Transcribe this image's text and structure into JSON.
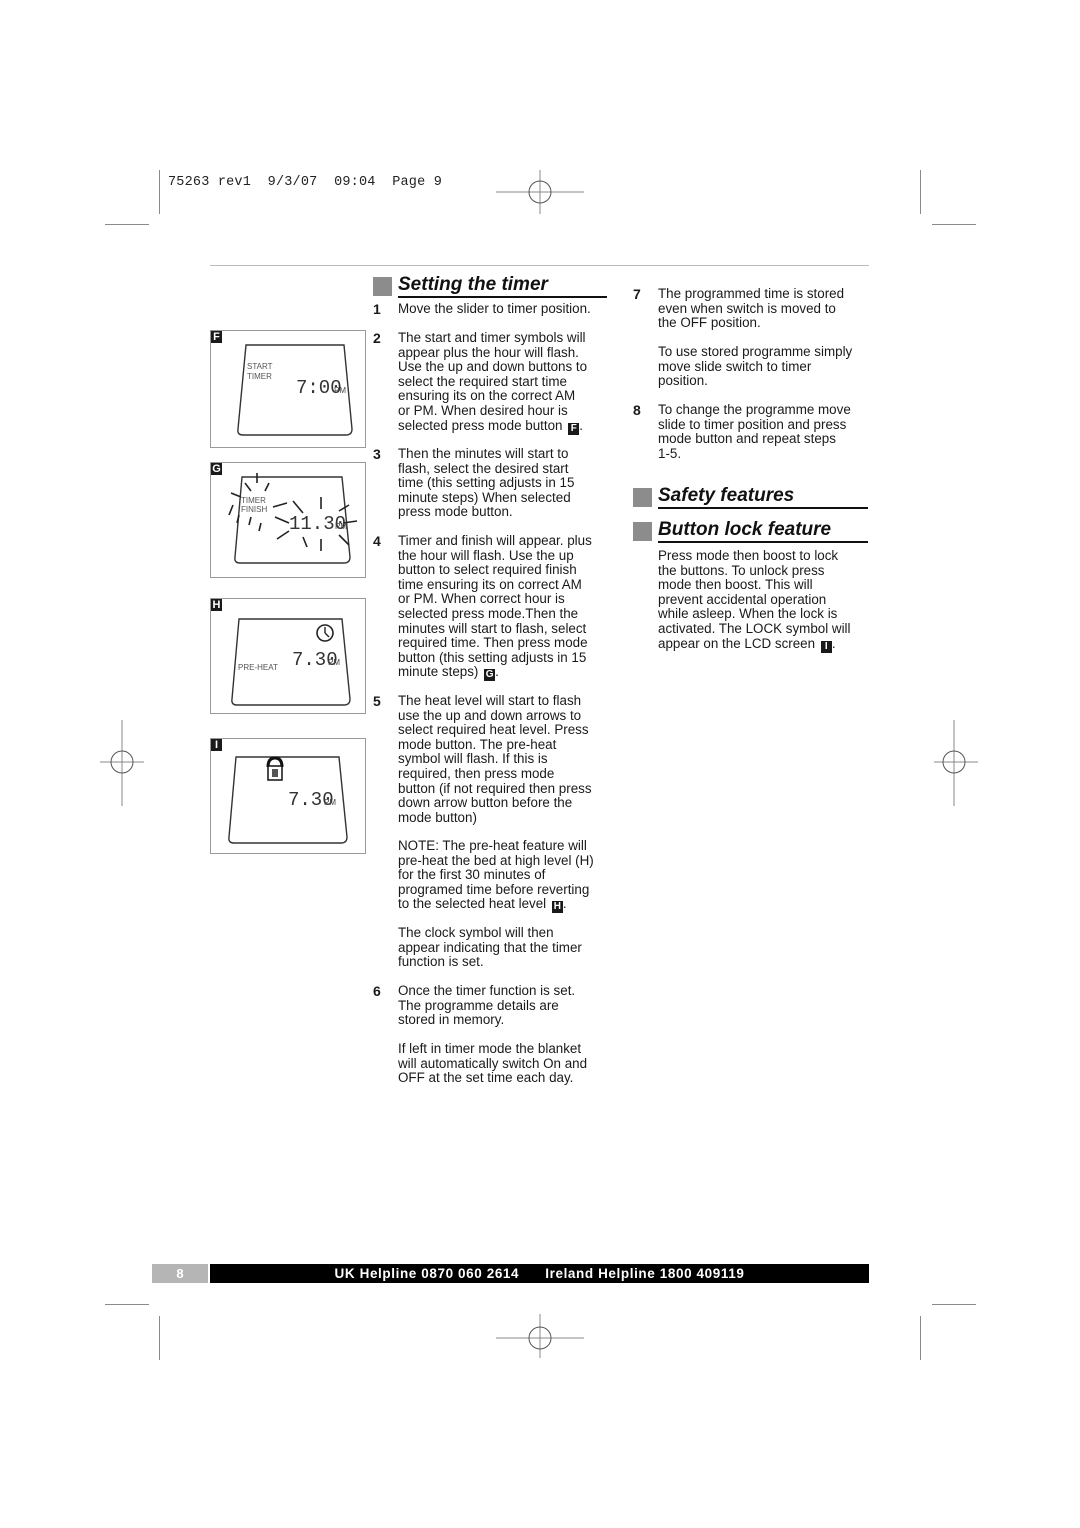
{
  "slug": {
    "job": "75263",
    "rev": "rev1",
    "date": "9/3/07",
    "time": "09:04",
    "page": "Page 9"
  },
  "figures": [
    {
      "letter": "F",
      "labels": [
        "START",
        "TIMER"
      ],
      "time": "7:00",
      "ampm": "PM",
      "icon": "none"
    },
    {
      "letter": "G",
      "labels": [
        "TIMER",
        "FINISH"
      ],
      "time": "11.30",
      "ampm": "PM",
      "icon": "flash-rays"
    },
    {
      "letter": "H",
      "labels": [
        "PRE-HEAT"
      ],
      "time": "7.30",
      "ampm": "PM",
      "icon": "clock-icon"
    },
    {
      "letter": "I",
      "labels": [],
      "time": "7.30",
      "ampm": "PM",
      "icon": "lock-icon"
    }
  ],
  "sections": {
    "timer": {
      "title": "Setting the timer",
      "steps": [
        {
          "num": "1",
          "text": "Move the slider to timer position."
        },
        {
          "num": "2",
          "text": "The start and timer symbols will\nappear plus the hour will flash.\nUse the up and down buttons to\nselect the required start time\nensuring its on the correct AM\nor PM. When desired hour is\nselected press mode button",
          "ref": "F",
          "tail": "."
        },
        {
          "num": "3",
          "text": "Then the minutes will start to\nflash, select the desired start\ntime (this setting adjusts in 15\nminute steps) When selected\npress mode button."
        },
        {
          "num": "4",
          "text": "Timer and finish will appear. plus\nthe hour will flash. Use the up\nbutton to select required finish\ntime ensuring its on correct AM\nor PM. When correct hour is\nselected press mode.Then the\nminutes will start to flash, select\nrequired time. Then press mode\nbutton (this setting adjusts in 15\nminute steps)",
          "ref": "G",
          "tail": "."
        },
        {
          "num": "5",
          "text": "The heat level will start to flash\nuse the up and down arrows to\nselect required heat level. Press\nmode button. The pre-heat\nsymbol will flash. If this is\nrequired, then press mode\nbutton (if not required then press\ndown arrow button before the\nmode button)"
        },
        {
          "num": "6",
          "text": "Once the timer function is set.\nThe programme details are\nstored in memory."
        }
      ],
      "note": {
        "text": "NOTE: The pre-heat feature will\npre-heat the bed at high level (H)\nfor the  first 30 minutes of\nprogramed time before reverting\nto the selected heat level",
        "ref": "H",
        "tail": "."
      },
      "clock_para": "The clock symbol will then\nappear indicating that the timer\nfunction is set.",
      "left_in_timer_para": "If left in timer mode the blanket\nwill automatically switch On and\nOFF at the set time each day."
    },
    "stored": {
      "steps": [
        {
          "num": "7",
          "text": "The programmed time is stored\neven when switch is moved to\nthe OFF position."
        },
        {
          "num": "8",
          "text": "To change the programme move\nslide to timer position and press\nmode button and repeat steps\n1-5."
        }
      ],
      "use_stored_para": "To use stored programme simply\nmove slide switch to timer\nposition."
    },
    "safety": {
      "title": "Safety features"
    },
    "lock": {
      "title": "Button lock feature",
      "text": "Press mode then boost to lock\nthe buttons. To unlock press\nmode then boost. This will\nprevent accidental operation\nwhile asleep. When the lock is\nactivated. The LOCK symbol will\nappear on the LCD screen",
      "ref": "I",
      "tail": "."
    }
  },
  "footer": {
    "page_number": "8",
    "uk_helpline": "UK Helpline 0870 060 2614",
    "ireland_helpline": "Ireland Helpline 1800 409119"
  },
  "colors": {
    "heading_square": "#8c8c8c",
    "footer_bar": "#000000",
    "footer_page_box": "#b5b5b5"
  }
}
